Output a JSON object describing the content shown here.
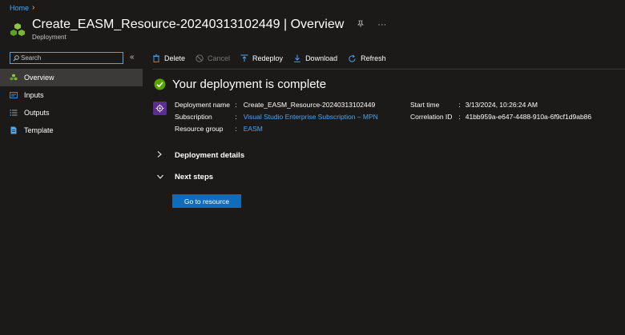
{
  "breadcrumb": {
    "home": "Home",
    "separator_icon": "chevron-right-icon"
  },
  "header": {
    "title": "Create_EASM_Resource-20240313102449 | Overview",
    "subtitle": "Deployment",
    "icon": "deployment-cubes-icon",
    "pin_icon": "pin-icon",
    "more_icon": "more-icon"
  },
  "sidebar": {
    "search": {
      "placeholder": "Search",
      "value": ""
    },
    "collapse_icon": "double-chevron-left-icon",
    "items": [
      {
        "label": "Overview",
        "icon": "cubes-icon",
        "active": true
      },
      {
        "label": "Inputs",
        "icon": "inputs-icon",
        "active": false
      },
      {
        "label": "Outputs",
        "icon": "outputs-icon",
        "active": false
      },
      {
        "label": "Template",
        "icon": "template-icon",
        "active": false
      }
    ]
  },
  "toolbar": {
    "delete": "Delete",
    "cancel": "Cancel",
    "redeploy": "Redeploy",
    "download": "Download",
    "refresh": "Refresh"
  },
  "status": {
    "title": "Your deployment is complete",
    "icon": "success-check-icon",
    "color": "#57a300"
  },
  "details": {
    "deployment_name_label": "Deployment name",
    "deployment_name": "Create_EASM_Resource-20240313102449",
    "subscription_label": "Subscription",
    "subscription": "Visual Studio Enterprise Subscription – MPN",
    "resource_group_label": "Resource group",
    "resource_group": "EASM",
    "start_time_label": "Start time",
    "start_time": "3/13/2024, 10:26:24 AM",
    "correlation_id_label": "Correlation ID",
    "correlation_id": "41bb959a-e647-4488-910a-6f9cf1d9ab86",
    "separator": ":"
  },
  "sections": {
    "deployment_details": "Deployment details",
    "next_steps": "Next steps"
  },
  "actions": {
    "go_to_resource": "Go to resource"
  },
  "colors": {
    "background": "#1b1a19",
    "accent": "#0f6cbd",
    "link": "#4ea5f0",
    "active_nav": "#3b3a39"
  }
}
